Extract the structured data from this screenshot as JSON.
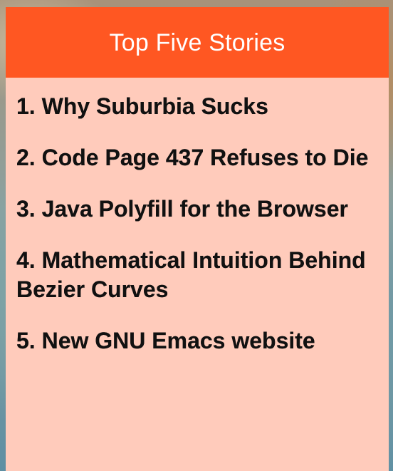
{
  "widget": {
    "title": "Top Five Stories",
    "stories": [
      "1. Why Suburbia Sucks",
      "2. Code Page 437 Refuses to Die",
      "3. Java Polyfill for the Browser",
      "4. Mathematical Intuition Behind Bezier Curves",
      "5. New GNU Emacs website"
    ]
  },
  "colors": {
    "header_bg": "#ff5722",
    "body_bg": "#ffcbbb",
    "header_text": "#ffffff",
    "story_text": "#111111"
  }
}
